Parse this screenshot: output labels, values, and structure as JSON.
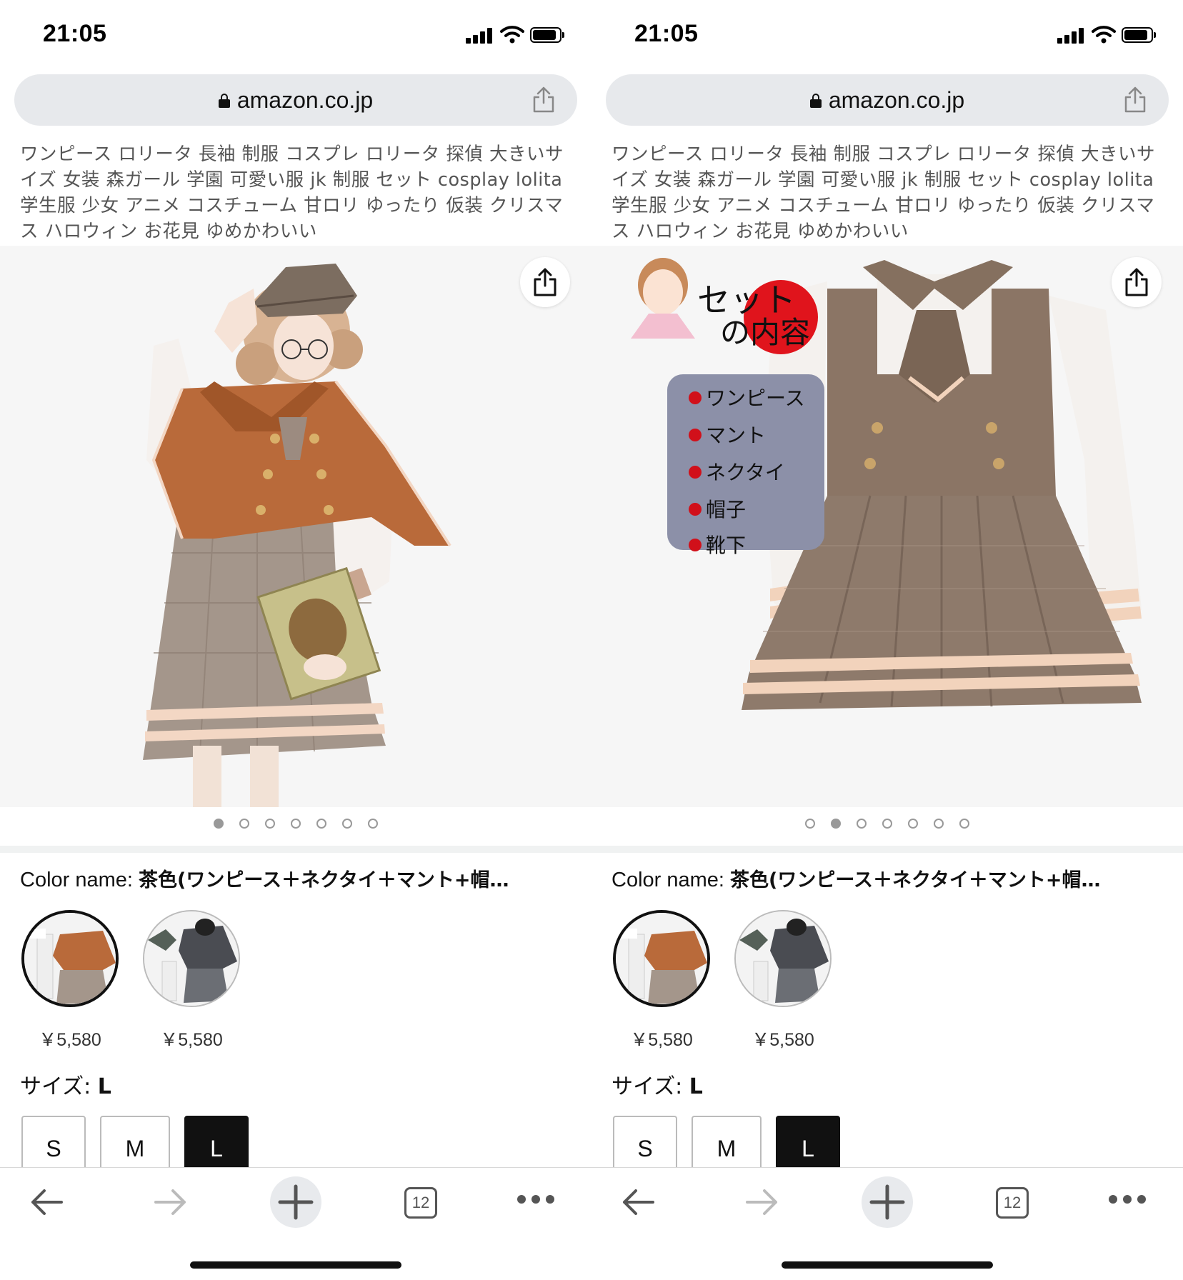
{
  "screens": [
    {
      "status": {
        "time": "21:05"
      },
      "browser": {
        "url": "amazon.co.jp",
        "tabs_count": "12"
      },
      "product": {
        "title": "ワンピース ロリータ 長袖 制服 コスプレ ロリータ 探偵 大きいサイズ 女装 森ガール 学園 可愛い服 jk 制服 セット cosplay lolita 学生服 少女 アニメ コスチューム 甘ロリ ゆったり 仮装 クリスマス ハロウィン お花見 ゆめかわいい",
        "image_index": 1,
        "image_count": 7
      },
      "color": {
        "label": "Color name: ",
        "value": "茶色(ワンピース＋ネクタイ＋マント+帽…",
        "options": [
          {
            "price": "￥5,580"
          },
          {
            "price": "￥5,580"
          }
        ]
      },
      "size": {
        "label": "サイズ: ",
        "value": "L",
        "options": [
          "S",
          "M",
          "L"
        ]
      }
    },
    {
      "status": {
        "time": "21:05"
      },
      "browser": {
        "url": "amazon.co.jp",
        "tabs_count": "12"
      },
      "product": {
        "title": "ワンピース ロリータ 長袖 制服 コスプレ ロリータ 探偵 大きいサイズ 女装 森ガール 学園 可愛い服 jk 制服 セット cosplay lolita 学生服 少女 アニメ コスチューム 甘ロリ ゆったり 仮装 クリスマス ハロウィン お花見 ゆめかわいい",
        "image_index": 2,
        "image_count": 7,
        "set_box": {
          "heading_1": "セット",
          "heading_2": "の内容",
          "items": [
            "ワンピース",
            "マント",
            "ネクタイ",
            "帽子",
            "靴下"
          ]
        }
      },
      "color": {
        "label": "Color name: ",
        "value": "茶色(ワンピース＋ネクタイ＋マント+帽…",
        "options": [
          {
            "price": "￥5,580"
          },
          {
            "price": "￥5,580"
          }
        ]
      },
      "size": {
        "label": "サイズ: ",
        "value": "L",
        "options": [
          "S",
          "M",
          "L"
        ]
      }
    }
  ],
  "icons": [
    "signal-icon",
    "wifi-icon",
    "battery-icon",
    "lock-icon",
    "share-icon",
    "back-arrow-icon",
    "forward-arrow-icon",
    "plus-icon",
    "tabs-icon",
    "more-icon"
  ],
  "colors": {
    "url_bar_bg": "#e7e9ec",
    "selected_size_bg": "#111111",
    "brown_cape": "#b96a3a",
    "plaid": "#8b7868"
  }
}
